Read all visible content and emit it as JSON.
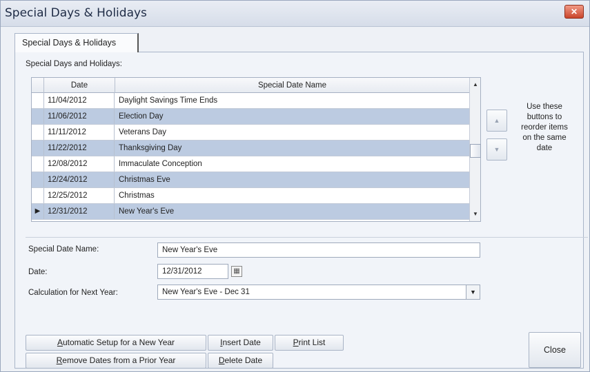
{
  "window": {
    "title": "Special Days & Holidays",
    "close_glyph": "✕"
  },
  "tab": {
    "label": "Special Days & Holidays"
  },
  "list": {
    "label": "Special Days and Holidays:",
    "columns": {
      "date": "Date",
      "name": "Special Date Name"
    },
    "rows": [
      {
        "date": "11/04/2012",
        "name": "Daylight Savings Time Ends",
        "indicator": ""
      },
      {
        "date": "11/06/2012",
        "name": "Election Day",
        "indicator": ""
      },
      {
        "date": "11/11/2012",
        "name": "Veterans Day",
        "indicator": ""
      },
      {
        "date": "11/22/2012",
        "name": "Thanksgiving Day",
        "indicator": ""
      },
      {
        "date": "12/08/2012",
        "name": "Immaculate Conception",
        "indicator": ""
      },
      {
        "date": "12/24/2012",
        "name": "Christmas Eve",
        "indicator": ""
      },
      {
        "date": "12/25/2012",
        "name": "Christmas",
        "indicator": ""
      },
      {
        "date": "12/31/2012",
        "name": "New Year's Eve",
        "indicator": "▶"
      }
    ],
    "selected_row_color": "#bccbe1"
  },
  "reorder": {
    "hint_lines": [
      "Use these",
      "buttons to",
      "reorder items",
      "on the same",
      "date"
    ],
    "up_glyph": "▲",
    "down_glyph": "▼"
  },
  "form": {
    "name_label": "Special Date Name:",
    "name_value": "New Year's Eve",
    "date_label": "Date:",
    "date_value": "12/31/2012",
    "calc_label": "Calculation for Next Year:",
    "calc_value": "New Year's Eve - Dec 31"
  },
  "buttons": {
    "auto_setup": {
      "accel": "A",
      "rest": "utomatic Setup for a New Year"
    },
    "remove_dates": {
      "accel": "R",
      "rest": "emove Dates from a Prior Year"
    },
    "insert_date": {
      "accel": "I",
      "rest": "nsert Date"
    },
    "delete_date": {
      "accel": "D",
      "rest": "elete Date"
    },
    "print_list": {
      "accel": "P",
      "rest": "rint List"
    },
    "close": "Close"
  }
}
